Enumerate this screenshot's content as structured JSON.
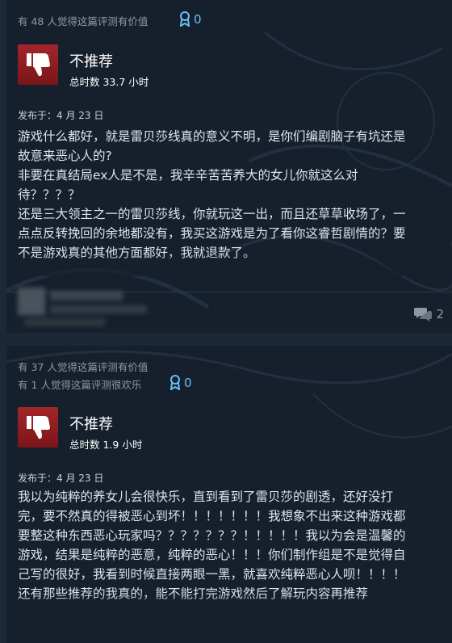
{
  "reviews": [
    {
      "helpful_lines": [
        "有 48 人觉得这篇评测有价值"
      ],
      "award_count": "0",
      "verdict": "不推荐",
      "hours": "总时数 33.7 小时",
      "posted": "发布于：4 月 23 日",
      "body_lines": [
        "游戏什么都好，就是雷贝莎线真的意义不明，是你们编剧脑子有坑还是",
        "故意来恶心人的?",
        "非要在真结局ex人是不是，我辛辛苦苦养大的女儿你就这么对",
        "待？？？？",
        "还是三大领主之一的雷贝莎线，你就玩这一出，而且还草草收场了，一",
        "点点反转挽回的余地都没有，我买这游戏是为了看你这睿哲剧情的？要",
        "不是游戏真的其他方面都好，我就退款了。"
      ],
      "comment_count": "2"
    },
    {
      "helpful_lines": [
        "有 37 人觉得这篇评测有价值",
        "有 1 人觉得这篇评测很欢乐"
      ],
      "award_count": "0",
      "verdict": "不推荐",
      "hours": "总时数 1.9 小时",
      "posted": "发布于：4 月 23 日",
      "body_lines": [
        "我以为纯粹的养女儿会很快乐，直到看到了雷贝莎的剧透，还好没打",
        "完，要不然真的得被恶心到坏！！！！！！！我想象不出来这种游戏都",
        "要整这种东西恶心玩家吗？？？？？？？！！！！！我以为会是温馨的",
        "游戏，结果是纯粹的恶意，纯粹的恶心！！！你们制作组是不是觉得自",
        "己写的很好，我看到时候直接两眼一黑，就喜欢纯粹恶心人呗！！！！",
        "还有那些推荐的我真的，能不能打完游戏然后了解玩内容再推荐"
      ]
    }
  ],
  "colors": {
    "page_bg": "#1b2838",
    "card_bg": "#16202d",
    "thumb_red": "#a3262b",
    "award_blue": "#66c0f4",
    "text_main": "#dde3e8",
    "text_muted": "#8f98a0"
  },
  "icons": [
    "award-ribbon-icon",
    "thumbs-down-icon",
    "comment-bubble-icon"
  ]
}
